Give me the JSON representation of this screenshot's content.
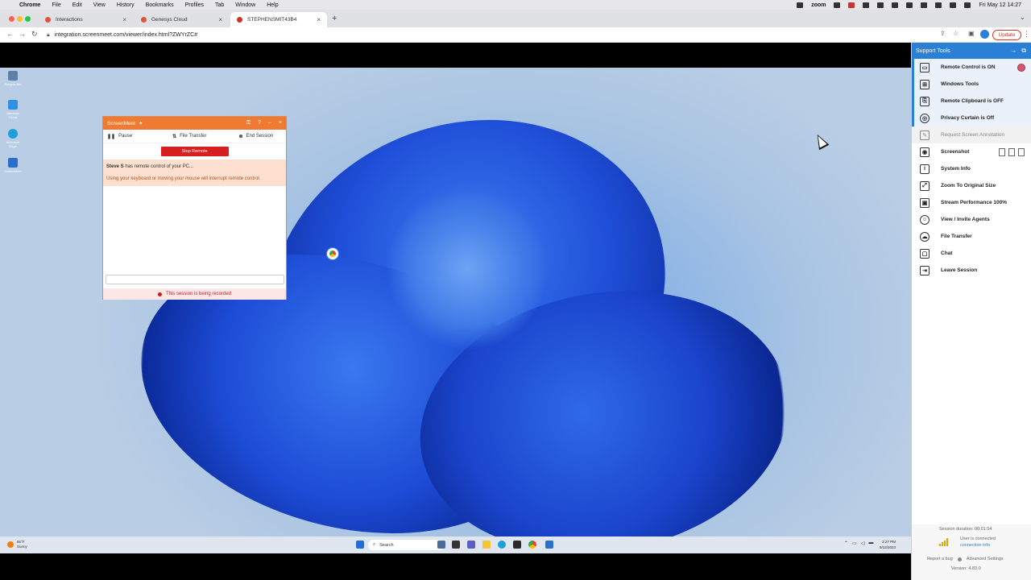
{
  "menubar": {
    "app": "Chrome",
    "items": [
      "File",
      "Edit",
      "View",
      "History",
      "Bookmarks",
      "Profiles",
      "Tab",
      "Window",
      "Help"
    ],
    "zoom_label": "zoom",
    "datetime": "Fri May 12  14:27"
  },
  "tabs": [
    {
      "label": "Interactions",
      "favicon_color": "#e0533f"
    },
    {
      "label": "Genesys Cloud",
      "favicon_color": "#e0533f"
    },
    {
      "label": "STEPHENSMIT43B4",
      "favicon_color": "#c9332b"
    }
  ],
  "address": {
    "url": "integration.screenmeet.com/viewer/index.html?ZWYrZC#",
    "update_label": "Update"
  },
  "desktop_icons": [
    {
      "label": "Recycle Bin",
      "color": "#5f7fa8"
    },
    {
      "label": "Genesys Cloud",
      "color": "#2f8fe0"
    },
    {
      "label": "Microsoft Edge",
      "color": "#1f9fd8"
    },
    {
      "label": "ScreenMeet",
      "color": "#2a6fc9"
    }
  ],
  "screenmeet_window": {
    "title": "ScreenMeet",
    "pause_label": "Pause",
    "file_transfer_label": "File Transfer",
    "end_session_label": "End Session",
    "stop_remote_label": "Stop Remote",
    "agent_name": "Steve S",
    "control_message": "has remote control of your PC...",
    "warning_message": "Using your keyboard or moving your mouse will interrupt remote control.",
    "recording_message": "This session is being recorded"
  },
  "taskbar": {
    "weather_temp": "66°F",
    "weather_desc": "Sunny",
    "search_placeholder": "Search",
    "clock_time": "2:27 PM",
    "clock_date": "5/12/2023"
  },
  "panel": {
    "title": "Support Tools",
    "tools": [
      {
        "label": "Remote Control is ON",
        "icon": "monitor-icon",
        "state": "on"
      },
      {
        "label": "Windows Tools",
        "icon": "windows-icon",
        "state": "normal"
      },
      {
        "label": "Remote Clipboard is OFF",
        "icon": "clipboard-icon",
        "state": "normal"
      },
      {
        "label": "Privacy Curtain is Off",
        "icon": "shield-icon",
        "state": "normal"
      },
      {
        "label": "Request Screen Annotation",
        "icon": "annotation-icon",
        "state": "disabled"
      },
      {
        "label": "Screenshot",
        "icon": "camera-icon",
        "state": "normal"
      },
      {
        "label": "System Info",
        "icon": "info-icon",
        "state": "normal"
      },
      {
        "label": "Zoom To Original Size",
        "icon": "zoom-icon",
        "state": "normal"
      },
      {
        "label": "Stream Performance 100%",
        "icon": "performance-icon",
        "state": "normal"
      },
      {
        "label": "View / Invite Agents",
        "icon": "agents-icon",
        "state": "normal"
      },
      {
        "label": "File Transfer",
        "icon": "file-transfer-icon",
        "state": "normal"
      },
      {
        "label": "Chat",
        "icon": "chat-icon",
        "state": "normal"
      },
      {
        "label": "Leave Session",
        "icon": "leave-icon",
        "state": "normal"
      }
    ],
    "session_duration": "Session duration: 00:01:54",
    "user_status": "User is connected",
    "connection_info": "connection info",
    "report_bug": "Report a bug",
    "advanced_settings": "Advanced Settings",
    "version": "Version: 4.83.0"
  },
  "colors": {
    "accent": "#2a7fd6",
    "screenmeet_orange": "#f07a32",
    "stop_red": "#d81f1f"
  }
}
